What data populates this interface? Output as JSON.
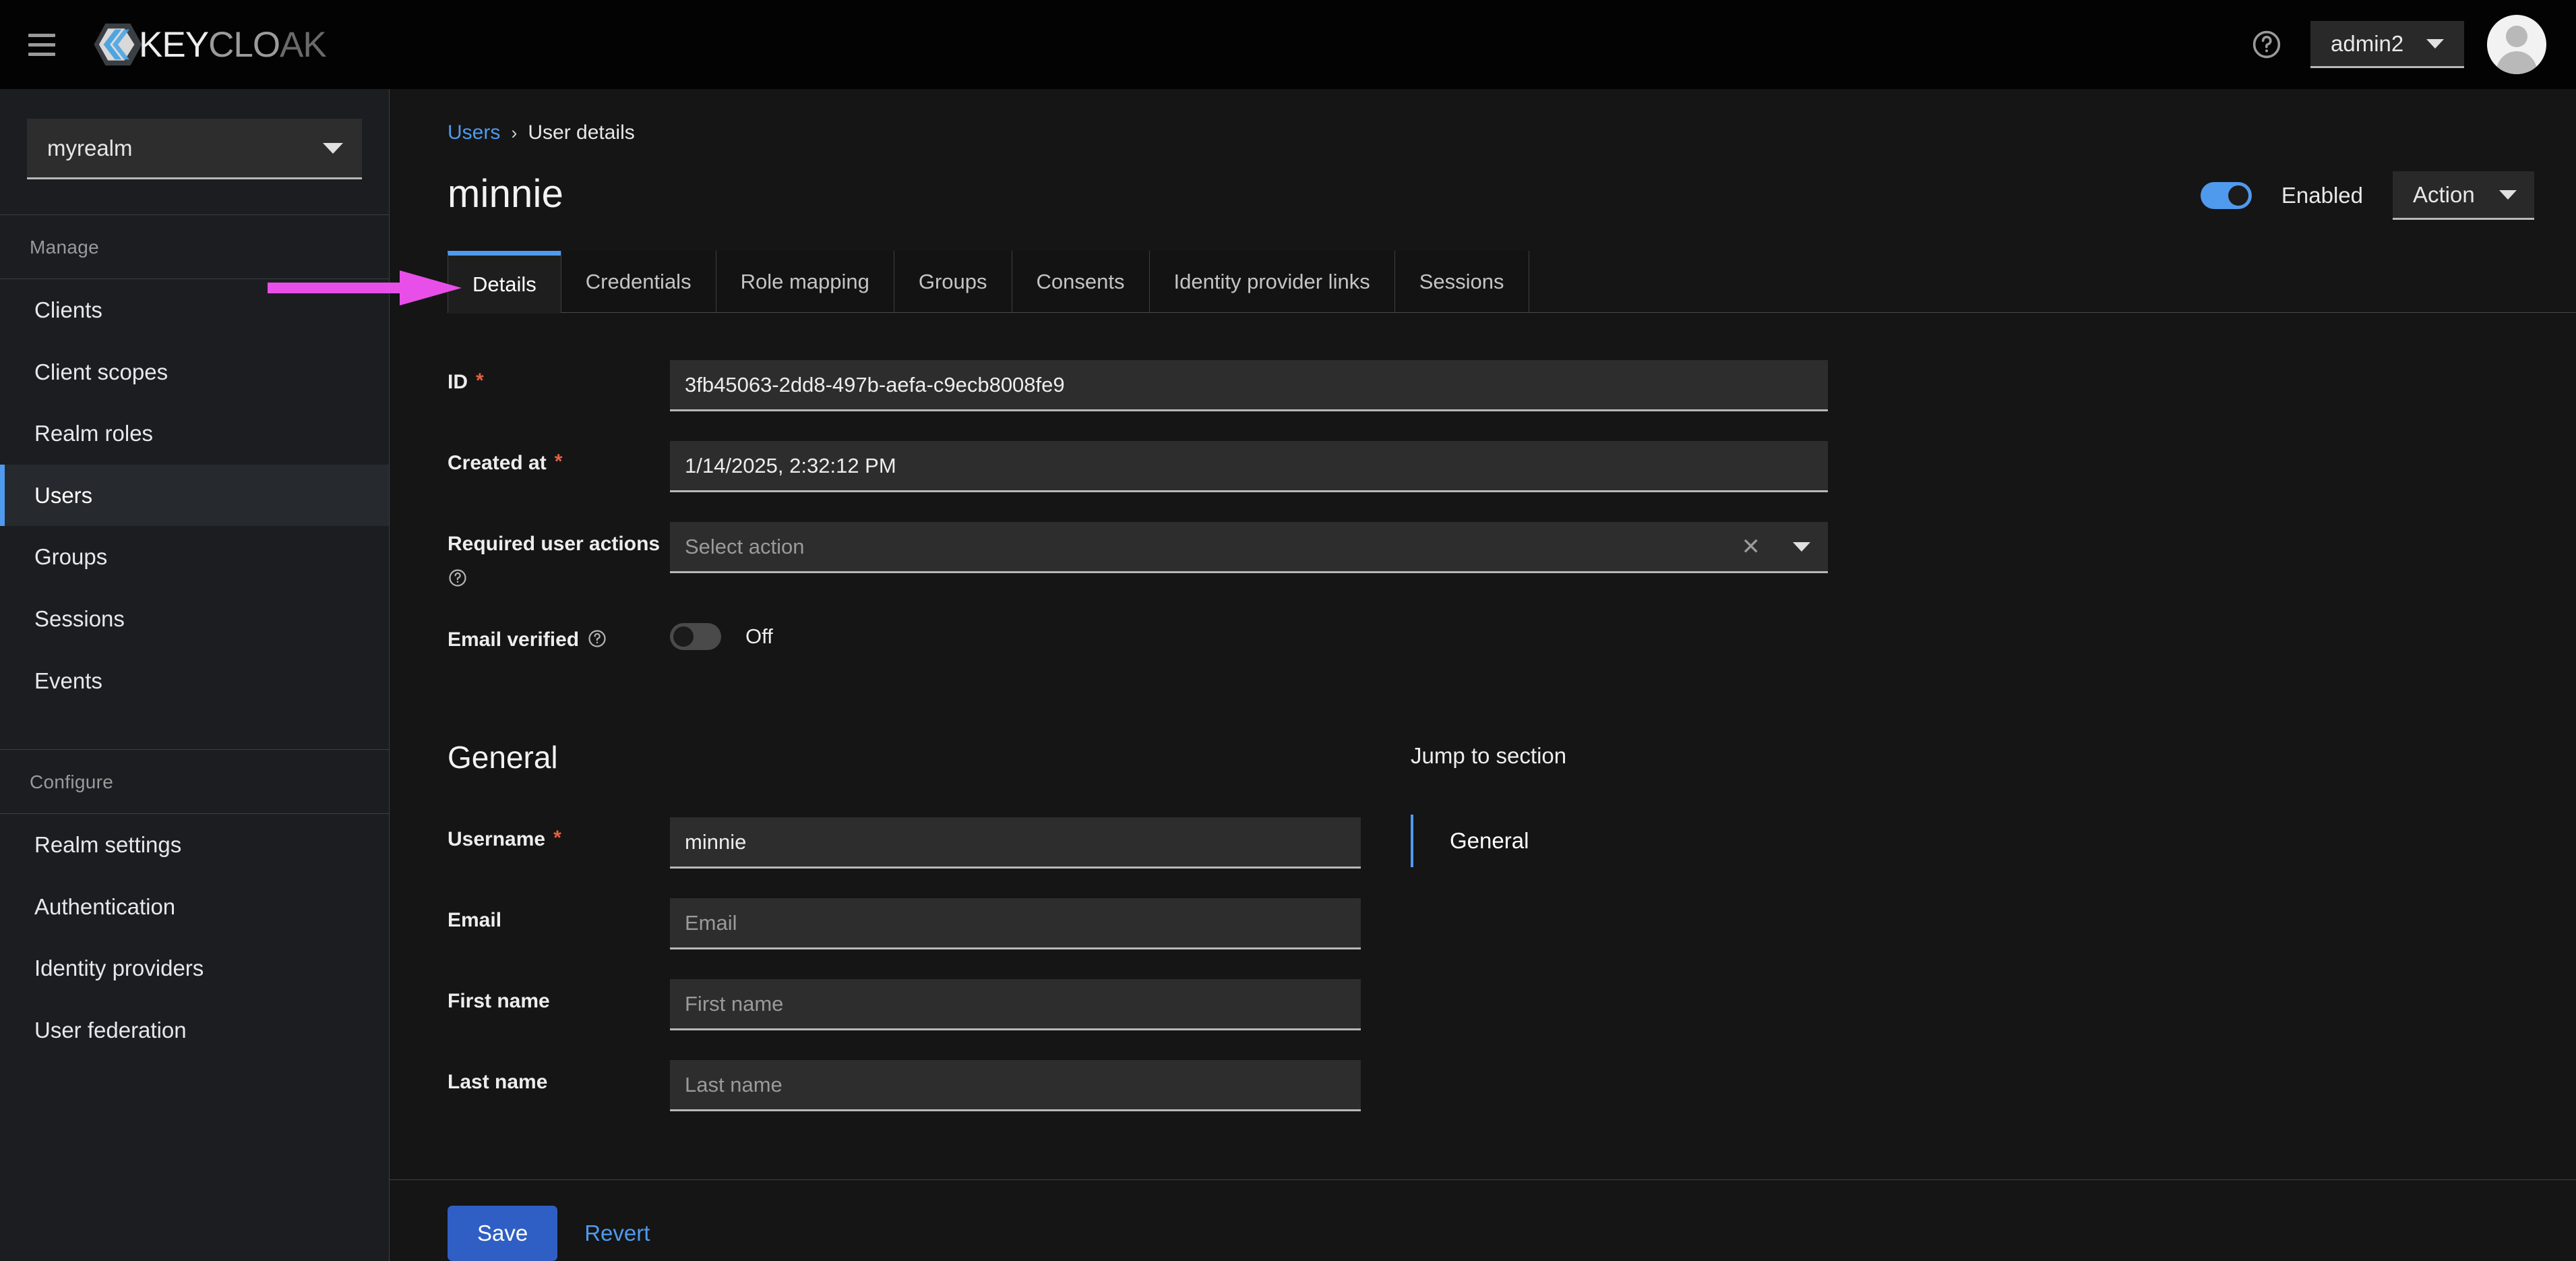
{
  "masthead": {
    "menu_icon": "hamburger-menu-icon",
    "brand_part1": "KEY",
    "brand_part2": "CLO",
    "brand_part3": "AK",
    "help_icon": "help-circle-icon",
    "user_menu_label": "admin2",
    "avatar_icon": "user-avatar-icon"
  },
  "sidebar": {
    "realm_selected": "myrealm",
    "groups": [
      {
        "title": "Manage",
        "items": [
          {
            "label": "Clients",
            "active": false
          },
          {
            "label": "Client scopes",
            "active": false
          },
          {
            "label": "Realm roles",
            "active": false
          },
          {
            "label": "Users",
            "active": true
          },
          {
            "label": "Groups",
            "active": false
          },
          {
            "label": "Sessions",
            "active": false
          },
          {
            "label": "Events",
            "active": false
          }
        ]
      },
      {
        "title": "Configure",
        "items": [
          {
            "label": "Realm settings",
            "active": false
          },
          {
            "label": "Authentication",
            "active": false
          },
          {
            "label": "Identity providers",
            "active": false
          },
          {
            "label": "User federation",
            "active": false
          }
        ]
      }
    ]
  },
  "page": {
    "breadcrumb_link": "Users",
    "breadcrumb_sep": "›",
    "breadcrumb_current": "User details",
    "title": "minnie",
    "enabled_label": "Enabled",
    "enabled_state": "on",
    "action_label": "Action"
  },
  "tabs": [
    {
      "label": "Details",
      "active": true
    },
    {
      "label": "Credentials",
      "active": false
    },
    {
      "label": "Role mapping",
      "active": false
    },
    {
      "label": "Groups",
      "active": false
    },
    {
      "label": "Consents",
      "active": false
    },
    {
      "label": "Identity provider links",
      "active": false
    },
    {
      "label": "Sessions",
      "active": false
    }
  ],
  "annotation": {
    "arrow_color": "#e84fe8",
    "arrow_points_at": "Details"
  },
  "form": {
    "id": {
      "label": "ID",
      "required": "*",
      "value": "3fb45063-2dd8-497b-aefa-c9ecb8008fe9"
    },
    "created_at": {
      "label": "Created at",
      "required": "*",
      "value": "1/14/2025, 2:32:12 PM"
    },
    "required_user_actions": {
      "label": "Required user actions",
      "placeholder": "Select action",
      "value": "",
      "clear_icon": "clear-x-icon",
      "toggle_icon": "chevron-down-icon",
      "help_icon": "help-circle-icon"
    },
    "email_verified": {
      "label": "Email verified",
      "help_icon": "help-circle-icon",
      "state_label": "Off",
      "state": "off"
    }
  },
  "general": {
    "heading": "General",
    "fields": [
      {
        "label": "Username",
        "required": "*",
        "value": "minnie",
        "placeholder": ""
      },
      {
        "label": "Email",
        "required": "",
        "value": "",
        "placeholder": "Email"
      },
      {
        "label": "First name",
        "required": "",
        "value": "",
        "placeholder": "First name"
      },
      {
        "label": "Last name",
        "required": "",
        "value": "",
        "placeholder": "Last name"
      }
    ]
  },
  "jump_to_section": {
    "title": "Jump to section",
    "items": [
      {
        "label": "General",
        "active": true
      }
    ]
  },
  "footer": {
    "save_label": "Save",
    "revert_label": "Revert"
  },
  "colors": {
    "accent_blue": "#4f9aed",
    "primary_button": "#2f5fc4",
    "required_red": "#e4603f",
    "annotation_magenta": "#e84fe8",
    "masthead_bg": "#030303",
    "sidebar_bg": "#1b1d21",
    "content_bg": "#151515",
    "input_bg": "#2d2d2d"
  }
}
